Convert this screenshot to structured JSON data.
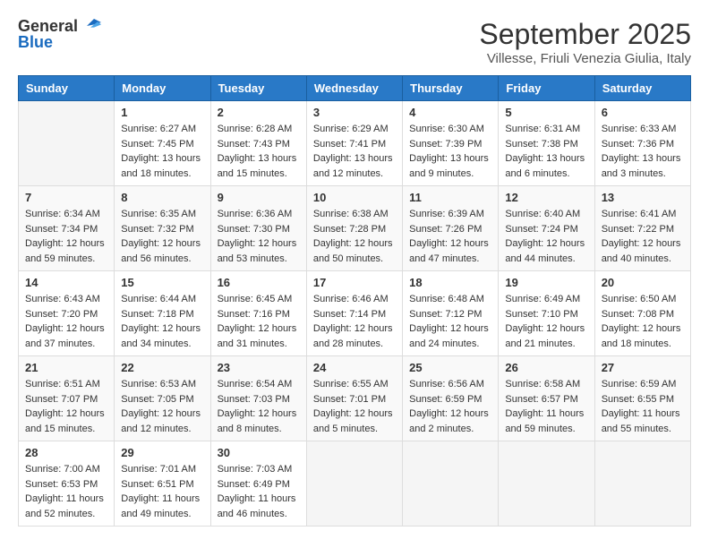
{
  "header": {
    "logo_general": "General",
    "logo_blue": "Blue",
    "month_title": "September 2025",
    "location": "Villesse, Friuli Venezia Giulia, Italy"
  },
  "weekdays": [
    "Sunday",
    "Monday",
    "Tuesday",
    "Wednesday",
    "Thursday",
    "Friday",
    "Saturday"
  ],
  "weeks": [
    [
      {
        "day": "",
        "info": ""
      },
      {
        "day": "1",
        "info": "Sunrise: 6:27 AM\nSunset: 7:45 PM\nDaylight: 13 hours\nand 18 minutes."
      },
      {
        "day": "2",
        "info": "Sunrise: 6:28 AM\nSunset: 7:43 PM\nDaylight: 13 hours\nand 15 minutes."
      },
      {
        "day": "3",
        "info": "Sunrise: 6:29 AM\nSunset: 7:41 PM\nDaylight: 13 hours\nand 12 minutes."
      },
      {
        "day": "4",
        "info": "Sunrise: 6:30 AM\nSunset: 7:39 PM\nDaylight: 13 hours\nand 9 minutes."
      },
      {
        "day": "5",
        "info": "Sunrise: 6:31 AM\nSunset: 7:38 PM\nDaylight: 13 hours\nand 6 minutes."
      },
      {
        "day": "6",
        "info": "Sunrise: 6:33 AM\nSunset: 7:36 PM\nDaylight: 13 hours\nand 3 minutes."
      }
    ],
    [
      {
        "day": "7",
        "info": "Sunrise: 6:34 AM\nSunset: 7:34 PM\nDaylight: 12 hours\nand 59 minutes."
      },
      {
        "day": "8",
        "info": "Sunrise: 6:35 AM\nSunset: 7:32 PM\nDaylight: 12 hours\nand 56 minutes."
      },
      {
        "day": "9",
        "info": "Sunrise: 6:36 AM\nSunset: 7:30 PM\nDaylight: 12 hours\nand 53 minutes."
      },
      {
        "day": "10",
        "info": "Sunrise: 6:38 AM\nSunset: 7:28 PM\nDaylight: 12 hours\nand 50 minutes."
      },
      {
        "day": "11",
        "info": "Sunrise: 6:39 AM\nSunset: 7:26 PM\nDaylight: 12 hours\nand 47 minutes."
      },
      {
        "day": "12",
        "info": "Sunrise: 6:40 AM\nSunset: 7:24 PM\nDaylight: 12 hours\nand 44 minutes."
      },
      {
        "day": "13",
        "info": "Sunrise: 6:41 AM\nSunset: 7:22 PM\nDaylight: 12 hours\nand 40 minutes."
      }
    ],
    [
      {
        "day": "14",
        "info": "Sunrise: 6:43 AM\nSunset: 7:20 PM\nDaylight: 12 hours\nand 37 minutes."
      },
      {
        "day": "15",
        "info": "Sunrise: 6:44 AM\nSunset: 7:18 PM\nDaylight: 12 hours\nand 34 minutes."
      },
      {
        "day": "16",
        "info": "Sunrise: 6:45 AM\nSunset: 7:16 PM\nDaylight: 12 hours\nand 31 minutes."
      },
      {
        "day": "17",
        "info": "Sunrise: 6:46 AM\nSunset: 7:14 PM\nDaylight: 12 hours\nand 28 minutes."
      },
      {
        "day": "18",
        "info": "Sunrise: 6:48 AM\nSunset: 7:12 PM\nDaylight: 12 hours\nand 24 minutes."
      },
      {
        "day": "19",
        "info": "Sunrise: 6:49 AM\nSunset: 7:10 PM\nDaylight: 12 hours\nand 21 minutes."
      },
      {
        "day": "20",
        "info": "Sunrise: 6:50 AM\nSunset: 7:08 PM\nDaylight: 12 hours\nand 18 minutes."
      }
    ],
    [
      {
        "day": "21",
        "info": "Sunrise: 6:51 AM\nSunset: 7:07 PM\nDaylight: 12 hours\nand 15 minutes."
      },
      {
        "day": "22",
        "info": "Sunrise: 6:53 AM\nSunset: 7:05 PM\nDaylight: 12 hours\nand 12 minutes."
      },
      {
        "day": "23",
        "info": "Sunrise: 6:54 AM\nSunset: 7:03 PM\nDaylight: 12 hours\nand 8 minutes."
      },
      {
        "day": "24",
        "info": "Sunrise: 6:55 AM\nSunset: 7:01 PM\nDaylight: 12 hours\nand 5 minutes."
      },
      {
        "day": "25",
        "info": "Sunrise: 6:56 AM\nSunset: 6:59 PM\nDaylight: 12 hours\nand 2 minutes."
      },
      {
        "day": "26",
        "info": "Sunrise: 6:58 AM\nSunset: 6:57 PM\nDaylight: 11 hours\nand 59 minutes."
      },
      {
        "day": "27",
        "info": "Sunrise: 6:59 AM\nSunset: 6:55 PM\nDaylight: 11 hours\nand 55 minutes."
      }
    ],
    [
      {
        "day": "28",
        "info": "Sunrise: 7:00 AM\nSunset: 6:53 PM\nDaylight: 11 hours\nand 52 minutes."
      },
      {
        "day": "29",
        "info": "Sunrise: 7:01 AM\nSunset: 6:51 PM\nDaylight: 11 hours\nand 49 minutes."
      },
      {
        "day": "30",
        "info": "Sunrise: 7:03 AM\nSunset: 6:49 PM\nDaylight: 11 hours\nand 46 minutes."
      },
      {
        "day": "",
        "info": ""
      },
      {
        "day": "",
        "info": ""
      },
      {
        "day": "",
        "info": ""
      },
      {
        "day": "",
        "info": ""
      }
    ]
  ]
}
